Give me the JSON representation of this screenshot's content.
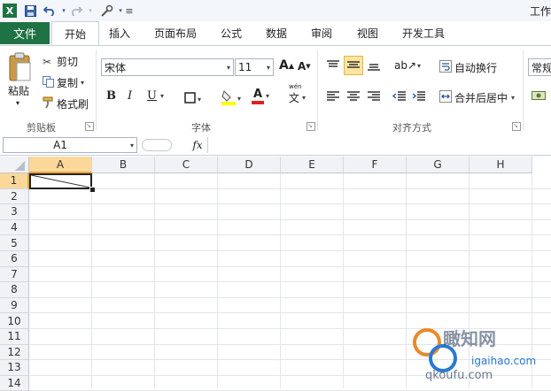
{
  "window": {
    "title": "工作"
  },
  "qat": {
    "icons": [
      "excel-icon",
      "save-icon",
      "undo-icon",
      "redo-icon",
      "customize-icon"
    ]
  },
  "tabs": [
    {
      "label": "文件",
      "active": false
    },
    {
      "label": "开始",
      "active": true
    },
    {
      "label": "插入"
    },
    {
      "label": "页面布局"
    },
    {
      "label": "公式"
    },
    {
      "label": "数据"
    },
    {
      "label": "审阅"
    },
    {
      "label": "视图"
    },
    {
      "label": "开发工具"
    }
  ],
  "clipboard": {
    "paste_label": "粘贴",
    "cut_label": "剪切",
    "copy_label": "复制",
    "format_painter_label": "格式刷",
    "group_label": "剪贴板"
  },
  "font": {
    "family": "宋体",
    "size": "11",
    "bold_label": "B",
    "italic_label": "I",
    "underline_label": "U",
    "grow_label": "A",
    "shrink_label": "A",
    "font_color_label": "A",
    "phonetic_label": "wén",
    "group_label": "字体",
    "font_color": "#e0201e",
    "fill_color": "#ffff00"
  },
  "alignment": {
    "wrap_label": "自动换行",
    "merge_label": "合并后居中",
    "group_label": "对齐方式"
  },
  "number": {
    "format": "常规"
  },
  "formula_bar": {
    "name_box": "A1",
    "fx_label": "fx",
    "value": ""
  },
  "sheet": {
    "columns": [
      "A",
      "B",
      "C",
      "D",
      "E",
      "F",
      "G",
      "H"
    ],
    "rows": [
      "1",
      "2",
      "3",
      "4",
      "5",
      "6",
      "7",
      "8",
      "9",
      "10",
      "11",
      "12",
      "13",
      "14"
    ],
    "active_cell": "A1"
  },
  "watermark": {
    "line1": "瞰知网",
    "line2": "igaihao.com",
    "line3": "qkoufu.com"
  }
}
